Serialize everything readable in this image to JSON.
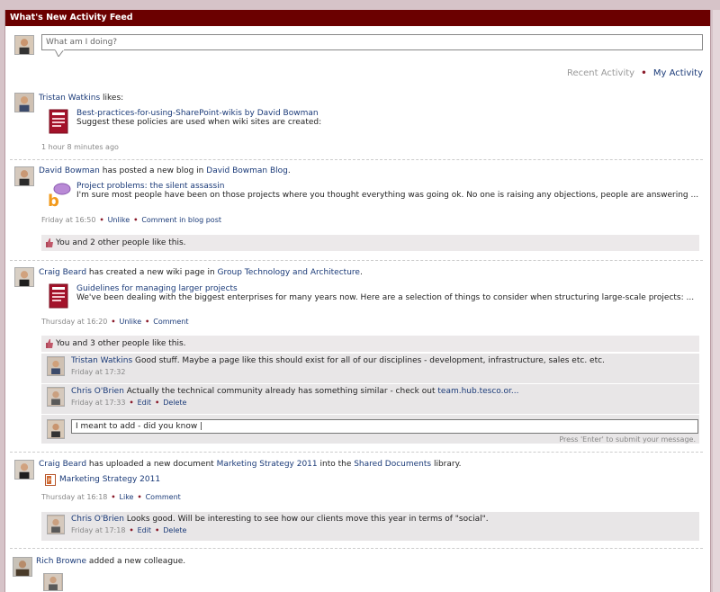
{
  "feed": {
    "title": "What's New Activity Feed"
  },
  "status": {
    "placeholder": "What am I doing?"
  },
  "tabs": {
    "recent": "Recent Activity",
    "separator": "•",
    "mine": "My Activity"
  },
  "items": [
    {
      "actor": "Tristan Watkins",
      "action": " likes:",
      "doc_title": "Best-practices-for-using-SharePoint-wikis by David Bowman",
      "doc_desc": "Suggest these policies are used when wiki sites are created:",
      "time": "1 hour 8 minutes ago"
    },
    {
      "actor": "David Bowman",
      "action": " has posted a new blog in ",
      "target": "David Bowman Blog",
      "post_title": "Project problems: the silent assassin",
      "post_desc": "I'm sure most people have been on those projects where you thought everything was going ok.  No one is raising any objections, people are answering ...",
      "time": "Friday at 16:50",
      "a1": "Unlike",
      "a2": "Comment in blog post",
      "likes": "You and 2 other people like this."
    },
    {
      "actor": "Craig Beard",
      "action": " has created a new wiki page in ",
      "target": "Group Technology and Architecture",
      "post_title": "Guidelines for managing larger projects",
      "post_desc": "We've been dealing with the biggest enterprises for many years now. Here are a selection of things to consider when structuring large-scale projects: ...",
      "time": "Thursday at 16:20",
      "a1": "Unlike",
      "a2": "Comment",
      "likes": "You and 3 other people like this.",
      "comments": [
        {
          "author": "Tristan Watkins",
          "text": " Good stuff. Maybe a page like this should exist for all of our disciplines - development, infrastructure, sales etc. etc.",
          "time": "Friday at 17:32"
        },
        {
          "author": "Chris O'Brien",
          "text": " Actually the technical community already has something similar - check out ",
          "link": "team.hub.tesco.or...",
          "time": "Friday at 17:33",
          "edit": "Edit",
          "delete": "Delete"
        }
      ],
      "reply_value": "I meant to add - did you know |",
      "reply_hint": "Press 'Enter' to submit your message."
    },
    {
      "actor": "Craig Beard",
      "action": " has uploaded a new document ",
      "target": "Marketing Strategy 2011",
      "action2": " into the ",
      "target2": "Shared Documents",
      "action3": " library.",
      "doc_title": "Marketing Strategy 2011",
      "time": "Thursday at 16:18",
      "a1": "Like",
      "a2": "Comment",
      "comment": {
        "author": "Chris O'Brien",
        "text": " Looks good. Will be interesting to see how our clients move this year in terms of \"social\".",
        "time": "Friday at 17:18",
        "edit": "Edit",
        "delete": "Delete"
      }
    },
    {
      "actor": "Rich Browne",
      "action": " added a new colleague."
    }
  ],
  "colors": {
    "titlebar": "#6b0000",
    "link": "#1a3a78",
    "accent_dot": "#8a1a2a"
  }
}
